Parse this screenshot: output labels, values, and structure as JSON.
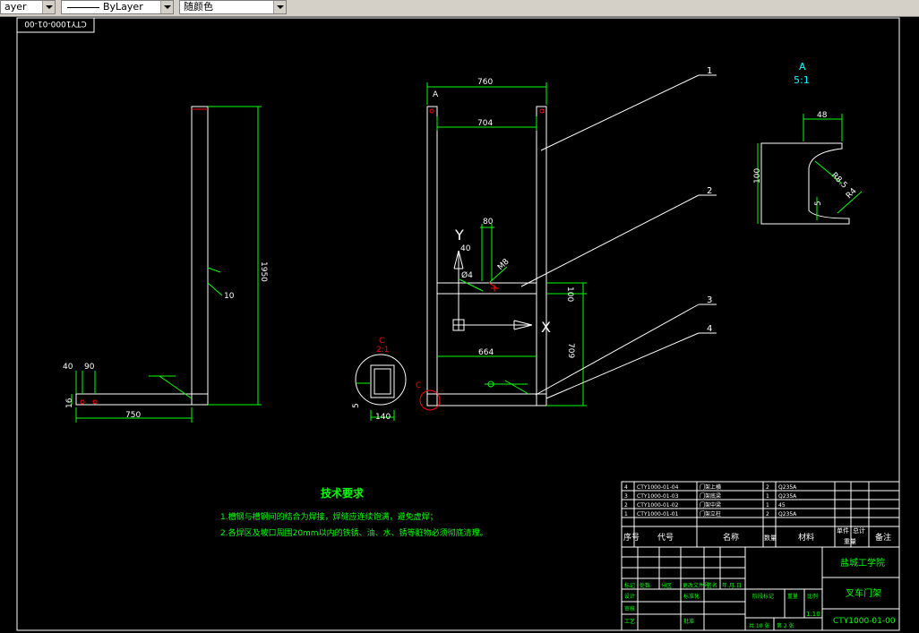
{
  "toolbar": {
    "layer_combo_value": "ayer",
    "linetype_combo_value": "ByLayer",
    "color_combo_value": "随颜色"
  },
  "drawing": {
    "frame_code_rotated": "CTY1000-01-00",
    "side_view": {
      "dim_height": "1950",
      "dim_weld": "10",
      "dim_40": "40",
      "dim_90": "90",
      "dim_16": "16",
      "dim_750": "750"
    },
    "front_view": {
      "label_a": "A",
      "dim_760": "760",
      "dim_704": "704",
      "dim_80": "80",
      "dim_40": "40",
      "dim_phi4": "Ø4",
      "dim_m8": "M8",
      "dim_100": "100",
      "dim_664": "664",
      "dim_709": "709",
      "label_c": "C",
      "axis_y": "Y",
      "axis_x": "X"
    },
    "detail_c": {
      "title_c": "C",
      "title_scale": "2:1",
      "dim_5": "5",
      "dim_140": "140"
    },
    "section_a": {
      "title": "A",
      "scale": "5:1",
      "dim_48": "48",
      "dim_100": "100",
      "dim_r8_5": "R8.5",
      "dim_r4": "R4",
      "dim_5": "5"
    },
    "balloons": [
      "1",
      "2",
      "3",
      "4"
    ]
  },
  "technical_requirements": {
    "title": "技术要求",
    "items": [
      "1.槽钢与槽钢间的结合为焊接，焊缝应连续饱满，避免虚焊；",
      "2.各焊区及坡口周围20mm以内的铁锈、油、水、锈等脏物必须彻底清理。"
    ]
  },
  "bom": {
    "rows": [
      {
        "no": "4",
        "code": "CTY1000-01-04",
        "name": "门架上横",
        "qty": "2",
        "material": "Q235A"
      },
      {
        "no": "3",
        "code": "CTY1000-01-03",
        "name": "门架底梁",
        "qty": "1",
        "material": "Q235A"
      },
      {
        "no": "2",
        "code": "CTY1000-01-02",
        "name": "门架中梁",
        "qty": "1",
        "material": "45"
      },
      {
        "no": "1",
        "code": "CTY1000-01-01",
        "name": "门架立柱",
        "qty": "2",
        "material": "Q235A"
      }
    ],
    "header": {
      "no": "序号",
      "code": "代号",
      "name": "名称",
      "qty": "数量",
      "material": "材料",
      "unit_weight": "单件",
      "total_weight": "总计",
      "weight": "重量",
      "remark": "备注"
    }
  },
  "title_block": {
    "school": "盐城工学院",
    "drawing_name": "叉车门架",
    "drawing_code": "CTY1000-01-00",
    "scale": "1:10",
    "stage_mark": "阶段标记",
    "weight": "重量",
    "scale_label": "比例",
    "sheets": "共  10  张",
    "sheet": "第  2  张",
    "rev_cols": [
      "标记",
      "处数",
      "分区",
      "更改文件号",
      "签名",
      "年.月.日"
    ],
    "role_design": "设计",
    "role_std": "标准化",
    "role_review": "审核",
    "role_process": "工艺",
    "role_approve": "批准"
  }
}
